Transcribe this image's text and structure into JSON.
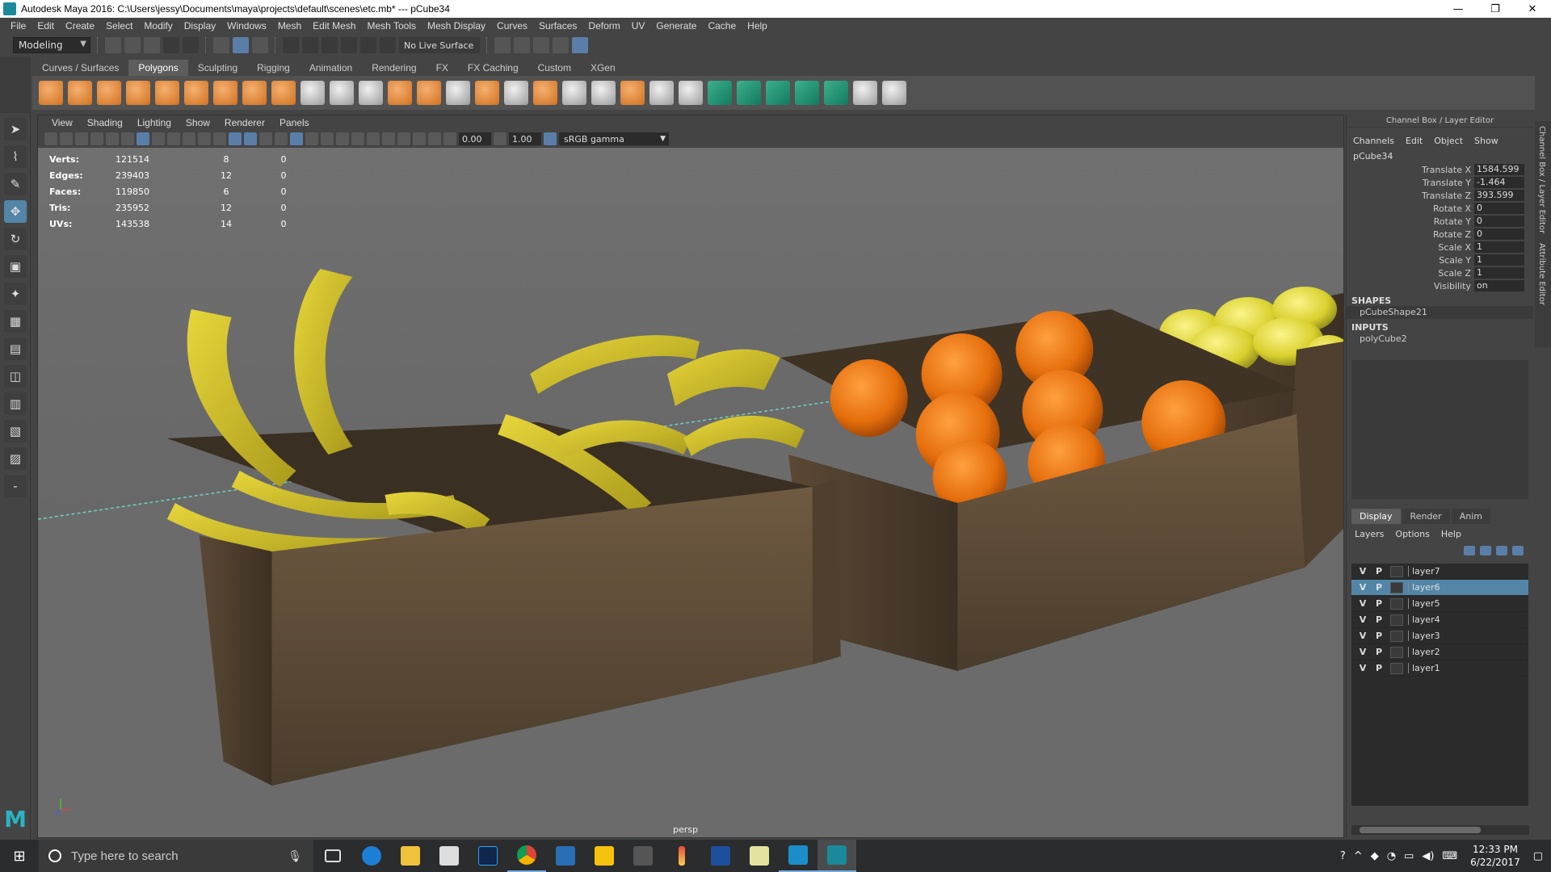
{
  "window": {
    "title": "Autodesk Maya 2016: C:\\Users\\jessy\\Documents\\maya\\projects\\default\\scenes\\etc.mb*  ---  pCube34",
    "minimize": "—",
    "maximize": "❐",
    "close": "✕"
  },
  "menubar": [
    "File",
    "Edit",
    "Create",
    "Select",
    "Modify",
    "Display",
    "Windows",
    "Mesh",
    "Edit Mesh",
    "Mesh Tools",
    "Mesh Display",
    "Curves",
    "Surfaces",
    "Deform",
    "UV",
    "Generate",
    "Cache",
    "Help"
  ],
  "statusline": {
    "mode": "Modeling",
    "live_surface": "No Live Surface"
  },
  "shelf": {
    "tabs": [
      "Curves / Surfaces",
      "Polygons",
      "Sculpting",
      "Rigging",
      "Animation",
      "Rendering",
      "FX",
      "FX Caching",
      "Custom",
      "XGen"
    ],
    "active_tab": "Polygons"
  },
  "panel": {
    "menu": [
      "View",
      "Shading",
      "Lighting",
      "Show",
      "Renderer",
      "Panels"
    ],
    "near_clip": "0.00",
    "far_clip": "1.00",
    "color_space": "sRGB gamma",
    "camera": "persp"
  },
  "hud": [
    {
      "label": "Verts:",
      "total": "121514",
      "selected": "8",
      "components": "0"
    },
    {
      "label": "Edges:",
      "total": "239403",
      "selected": "12",
      "components": "0"
    },
    {
      "label": "Faces:",
      "total": "119850",
      "selected": "6",
      "components": "0"
    },
    {
      "label": "Tris:",
      "total": "235952",
      "selected": "12",
      "components": "0"
    },
    {
      "label": "UVs:",
      "total": "143538",
      "selected": "14",
      "components": "0"
    }
  ],
  "channel_box": {
    "title": "Channel Box / Layer Editor",
    "menu": [
      "Channels",
      "Edit",
      "Object",
      "Show"
    ],
    "object": "pCube34",
    "attributes": [
      {
        "name": "Translate X",
        "value": "1584.599"
      },
      {
        "name": "Translate Y",
        "value": "-1.464"
      },
      {
        "name": "Translate Z",
        "value": "393.599"
      },
      {
        "name": "Rotate X",
        "value": "0"
      },
      {
        "name": "Rotate Y",
        "value": "0"
      },
      {
        "name": "Rotate Z",
        "value": "0"
      },
      {
        "name": "Scale X",
        "value": "1"
      },
      {
        "name": "Scale Y",
        "value": "1"
      },
      {
        "name": "Scale Z",
        "value": "1"
      },
      {
        "name": "Visibility",
        "value": "on"
      }
    ],
    "shapes_header": "SHAPES",
    "shape": "pCubeShape21",
    "inputs_header": "INPUTS",
    "input": "polyCube2"
  },
  "layer_editor": {
    "tabs": [
      "Display",
      "Render",
      "Anim"
    ],
    "active_tab": "Display",
    "menu": [
      "Layers",
      "Options",
      "Help"
    ],
    "layers": [
      {
        "v": "V",
        "p": "P",
        "name": "layer7",
        "selected": false
      },
      {
        "v": "V",
        "p": "P",
        "name": "layer6",
        "selected": true
      },
      {
        "v": "V",
        "p": "P",
        "name": "layer5",
        "selected": false
      },
      {
        "v": "V",
        "p": "P",
        "name": "layer4",
        "selected": false
      },
      {
        "v": "V",
        "p": "P",
        "name": "layer3",
        "selected": false
      },
      {
        "v": "V",
        "p": "P",
        "name": "layer2",
        "selected": false
      },
      {
        "v": "V",
        "p": "P",
        "name": "layer1",
        "selected": false
      }
    ]
  },
  "side_tabs": [
    "Channel Box / Layer Editor",
    "Attribute Editor"
  ],
  "taskbar": {
    "search_placeholder": "Type here to search",
    "time": "12:33 PM",
    "date": "6/22/2017"
  }
}
